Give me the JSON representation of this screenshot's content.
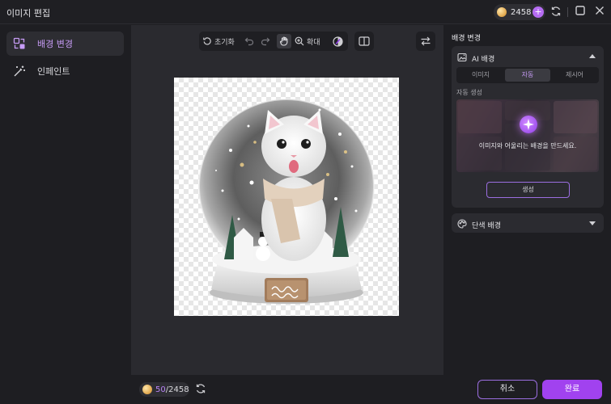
{
  "window": {
    "title": "이미지 편집",
    "credits": "2458"
  },
  "sidebar": {
    "items": [
      {
        "label": "배경 변경",
        "icon": "background-change-icon",
        "active": true
      },
      {
        "label": "인페인트",
        "icon": "magic-wand-icon",
        "active": false
      }
    ]
  },
  "toolbar": {
    "reset_label": "초기화",
    "zoom_label": "확대"
  },
  "bottombar": {
    "used": "50",
    "total": "/2458",
    "cancel_label": "취소",
    "done_label": "완료"
  },
  "panel": {
    "title": "배경 변경",
    "ai_section": {
      "label": "AI 배경",
      "tabs": [
        "이미지",
        "자동",
        "제시어"
      ],
      "active_tab": "자동",
      "sub_label": "자동 생성",
      "preview_text": "이미지와 어울리는 배경을 만드세요.",
      "generate_label": "생성"
    },
    "solid_section": {
      "label": "단색 배경"
    }
  },
  "colors": {
    "accent": "#a142ef",
    "accent_text": "#c79cf6",
    "background": "#1e1e22",
    "canvas_bg": "#2a2a2f"
  }
}
